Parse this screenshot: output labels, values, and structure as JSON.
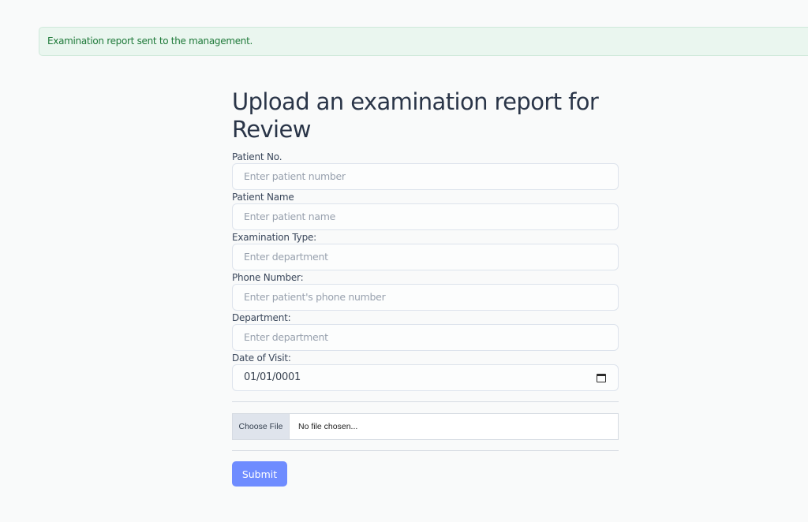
{
  "alert": {
    "message": "Examination report sent to the management."
  },
  "form": {
    "title": "Upload an examination report for Review",
    "fields": [
      {
        "label": "Patient No.",
        "placeholder": "Enter patient number"
      },
      {
        "label": "Patient Name",
        "placeholder": "Enter patient name"
      },
      {
        "label": "Examination Type:",
        "placeholder": "Enter department"
      },
      {
        "label": "Phone Number:",
        "placeholder": "Enter patient's phone number"
      },
      {
        "label": "Department:",
        "placeholder": "Enter department"
      },
      {
        "label": "Date of Visit:",
        "value": "01/01/0001"
      }
    ],
    "file": {
      "button_label": "Choose File",
      "status": "No file chosen..."
    },
    "submit_label": "Submit"
  },
  "colors": {
    "page_background": "#f9fafa",
    "alert_background": "#eaf6ef",
    "alert_text": "#1f7a3a",
    "submit_background": "#6f8cff"
  },
  "icons": {
    "date_picker": "calendar-icon"
  }
}
